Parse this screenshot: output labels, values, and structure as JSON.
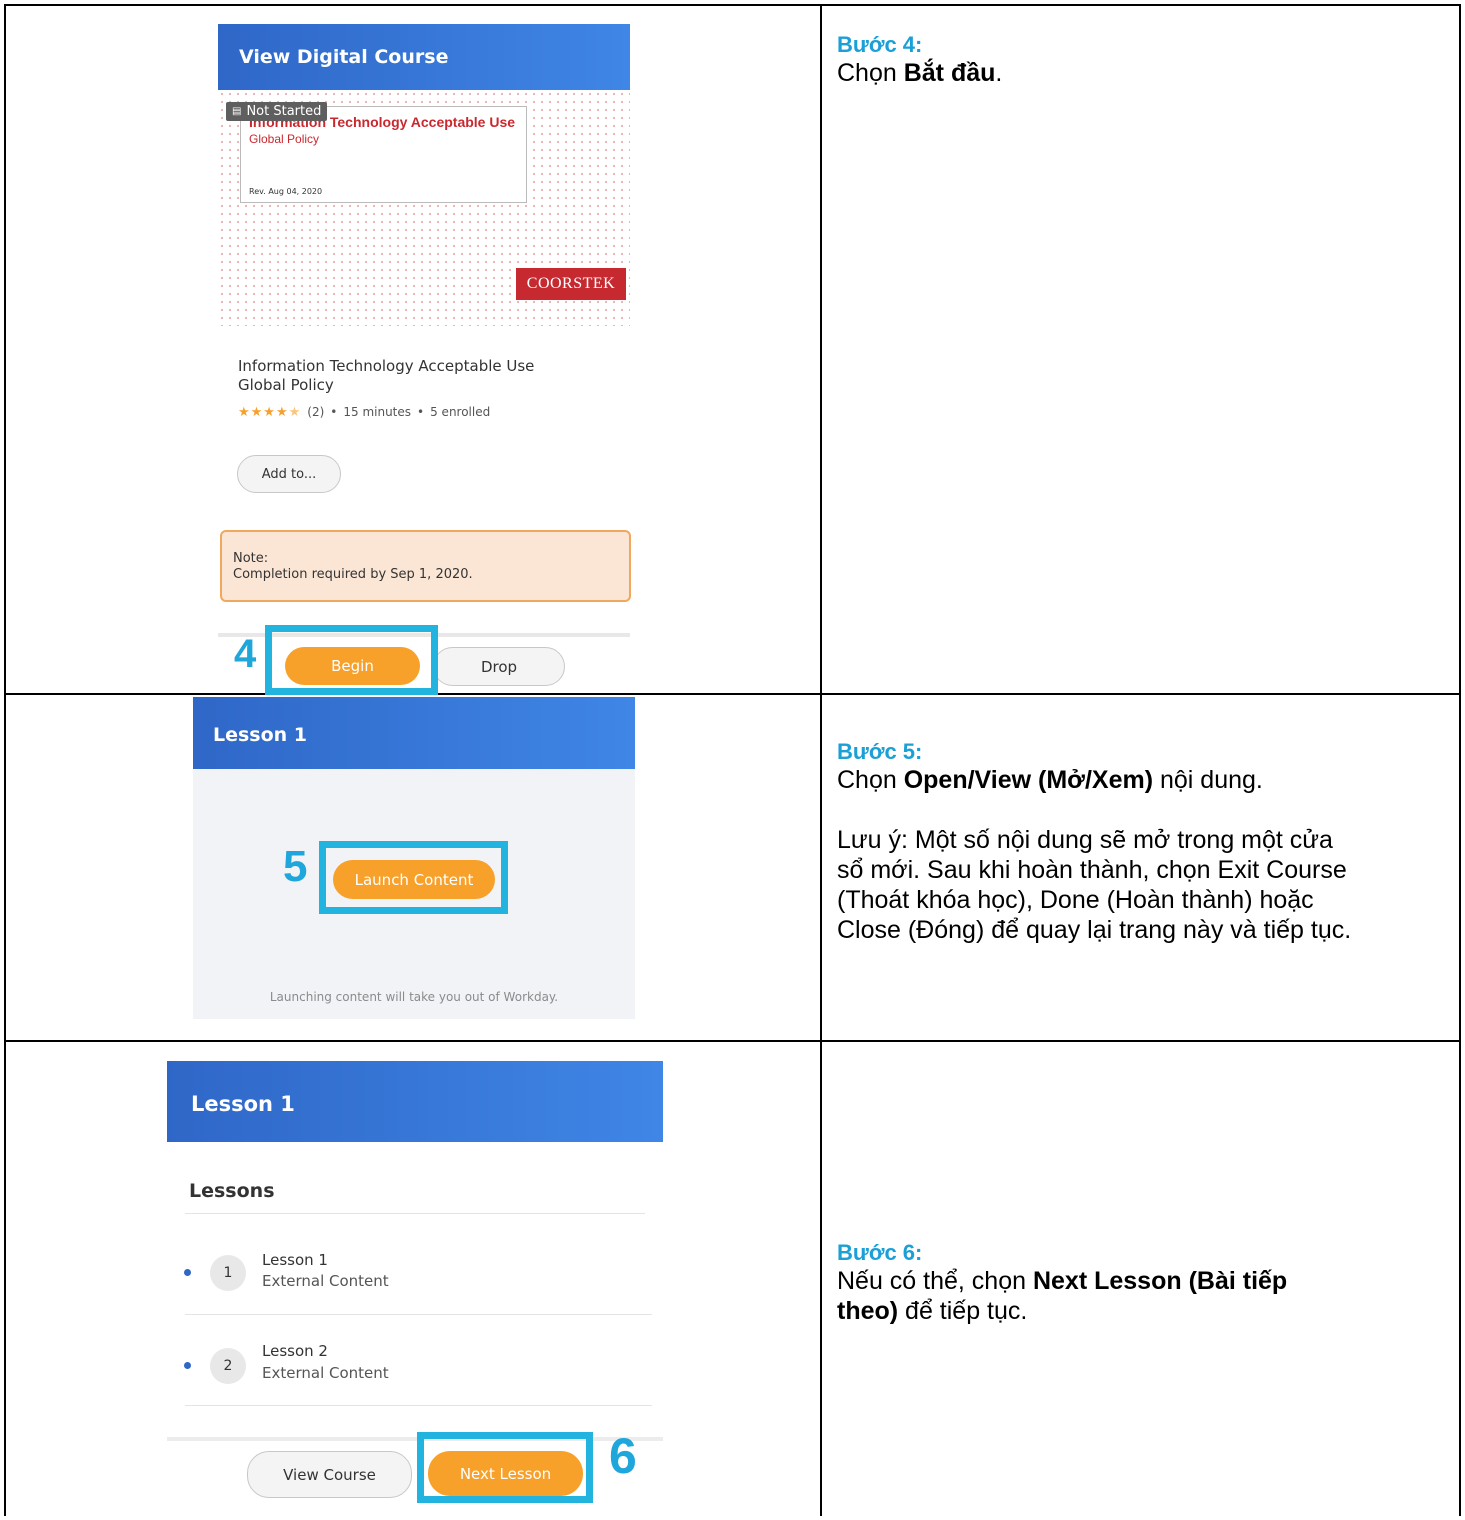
{
  "panel1": {
    "header": "View Digital Course",
    "status_tag": "Not Started",
    "card_title_line1": "Information Technology Acceptable Use",
    "card_title_line2": "Global Policy",
    "card_rev": "Rev. Aug 04, 2020",
    "logo": "COORSTEK",
    "course_title_line1": "Information Technology Acceptable Use",
    "course_title_line2": "Global Policy",
    "rating_count": "(2)",
    "rating_value": 4.5,
    "duration": "15 minutes",
    "enrolled": "5 enrolled",
    "add_to_label": "Add to...",
    "note_label": "Note:",
    "note_text": "Completion required by Sep 1, 2020.",
    "begin_label": "Begin",
    "drop_label": "Drop",
    "step_marker": "4"
  },
  "panel2": {
    "header": "Lesson 1",
    "launch_label": "Launch Content",
    "footer_text": "Launching content will take you out of Workday.",
    "step_marker": "5"
  },
  "panel3": {
    "header": "Lesson 1",
    "section_title": "Lessons",
    "lessons": [
      {
        "number": "1",
        "title": "Lesson 1",
        "subtitle": "External Content"
      },
      {
        "number": "2",
        "title": "Lesson 2",
        "subtitle": "External Content"
      }
    ],
    "view_course_label": "View Course",
    "next_lesson_label": "Next Lesson",
    "step_marker": "6"
  },
  "steps": {
    "s4": {
      "title": "Bước 4:",
      "pre": "Chọn ",
      "bold": "Bắt đầu",
      "post": "."
    },
    "s5": {
      "title": "Bước 5:",
      "pre": "Chọn ",
      "bold": "Open/View (Mở/Xem)",
      "post": " nội dung.",
      "note_l1": "Lưu ý: Một số nội dung sẽ mở trong một cửa",
      "note_l2": "sổ mới. Sau khi hoàn thành, chọn Exit Course",
      "note_l3": "(Thoát khóa học), Done (Hoàn thành) hoặc",
      "note_l4": "Close (Đóng) để quay lại trang này và tiếp tục."
    },
    "s6": {
      "title": "Bước 6:",
      "pre": "Nếu có thể, chọn ",
      "bold_l1": "Next Lesson (Bài tiếp",
      "bold_l2": "theo)",
      "post": " để tiếp tục."
    }
  },
  "colors": {
    "accent_step": "#1aa0d6",
    "highlight": "#22b3de",
    "orange_button": "#f7a02a",
    "header_blue": "#2f67c7"
  }
}
